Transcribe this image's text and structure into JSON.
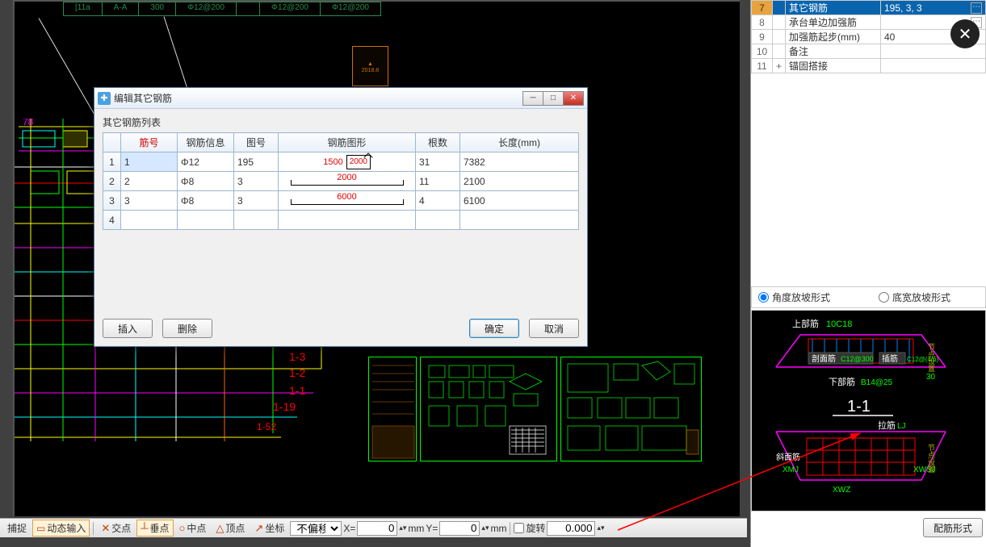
{
  "top_table": [
    "[11a",
    "A-A",
    "300",
    "Φ12@200",
    "",
    "Φ12@200",
    "Φ12@200"
  ],
  "dialog": {
    "title": "编辑其它钢筋",
    "subtitle": "其它钢筋列表",
    "headers": [
      "筋号",
      "钢筋信息",
      "图号",
      "钢筋图形",
      "根数",
      "长度(mm)"
    ],
    "rows": [
      {
        "n": "1",
        "num": "1",
        "info": "Φ12",
        "img": "195",
        "shape_val": "1500",
        "box_val": "2000",
        "qty": "31",
        "len": "7382"
      },
      {
        "n": "2",
        "num": "2",
        "info": "Φ8",
        "img": "3",
        "shape_val": "2000",
        "box_val": "",
        "qty": "11",
        "len": "2100"
      },
      {
        "n": "3",
        "num": "3",
        "info": "Φ8",
        "img": "3",
        "shape_val": "6000",
        "box_val": "",
        "qty": "4",
        "len": "6100"
      },
      {
        "n": "4",
        "num": "",
        "info": "",
        "img": "",
        "shape_val": "",
        "box_val": "",
        "qty": "",
        "len": ""
      }
    ],
    "btn_insert": "插入",
    "btn_delete": "删除",
    "btn_ok": "确定",
    "btn_cancel": "取消"
  },
  "props": [
    {
      "n": "7",
      "label": "其它钢筋",
      "val": "195, 3, 3",
      "sel": true,
      "dots": true
    },
    {
      "n": "8",
      "label": "承台单边加强筋",
      "val": "",
      "dots": true
    },
    {
      "n": "9",
      "label": "加强筋起步(mm)",
      "val": "40"
    },
    {
      "n": "10",
      "label": "备注",
      "val": ""
    },
    {
      "n": "11",
      "label": "锚固搭接",
      "val": "",
      "exp": "+"
    }
  ],
  "radio1": "角度放坡形式",
  "radio2": "底宽放坡形式",
  "diagram": {
    "top_label": "上部筋",
    "top_val": "10C18",
    "sec_label": "剖面筋",
    "sec_val": "C12@300",
    "face_label": "插筋",
    "face_val": "C12@(4/6)",
    "bot_label": "下部筋",
    "bot_val": "B14@25",
    "s11": "1-1",
    "la": "拉筋",
    "la_v": "LJ",
    "xm": "斜面筋",
    "xm_v": "XMJ",
    "xwsj": "XWSJ",
    "xwz": "XWZ",
    "jd": "节点设置",
    "ang": "30"
  },
  "btn_rebar_form": "配筋形式",
  "statusbar": {
    "b1": "捕捉",
    "b2": "动态输入",
    "b3": "交点",
    "b4": "垂点",
    "b5": "中点",
    "b6": "顶点",
    "b7": "坐标",
    "skew": "不偏移",
    "x_lbl": "X=",
    "x_val": "0",
    "mm": "mm",
    "y_lbl": "Y=",
    "y_val": "0",
    "rot_lbl": "旋转",
    "rot_val": "0.000"
  }
}
